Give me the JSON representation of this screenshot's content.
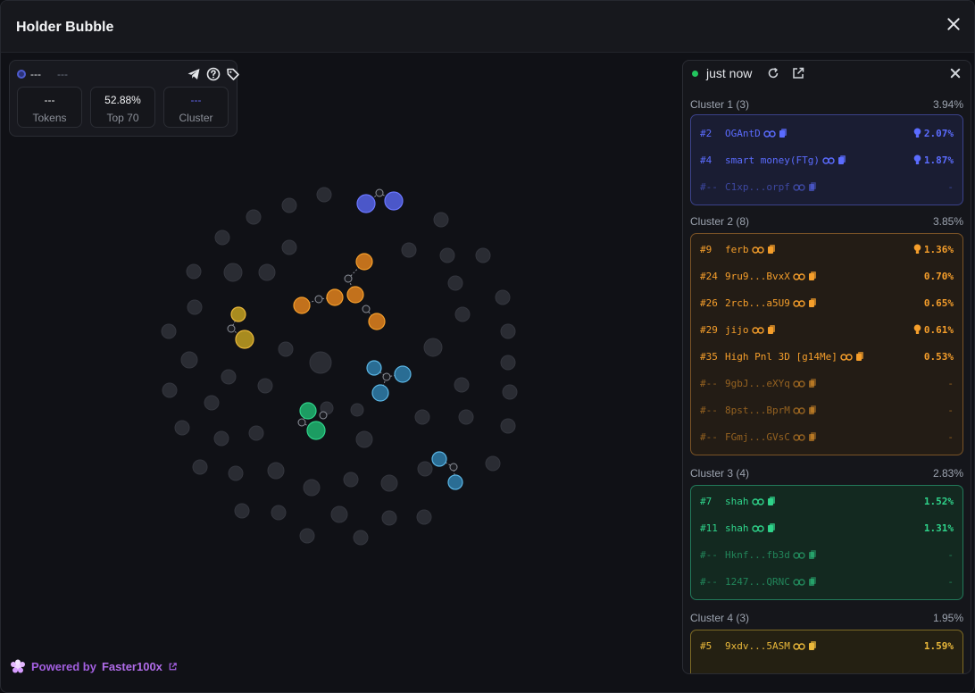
{
  "window": {
    "title": "Holder Bubble"
  },
  "token": {
    "name": "---",
    "symbol": "---"
  },
  "stats": [
    {
      "value": "---",
      "label": "Tokens"
    },
    {
      "value": "52.88%",
      "label": "Top 70"
    },
    {
      "value": "---",
      "label": "Cluster"
    }
  ],
  "panel": {
    "status": "just now"
  },
  "clusters": [
    {
      "title": "Cluster 1 (3)",
      "percent": "3.94%",
      "color": "#5b6cff",
      "bg": "#1a1d33",
      "border": "#3b428a",
      "rows": [
        {
          "rank": "#2",
          "name": "OGAntD",
          "percent": "2.07%",
          "bulb": true,
          "dim": false
        },
        {
          "rank": "#4",
          "name": "smart money(FTg)",
          "percent": "1.87%",
          "bulb": true,
          "dim": false
        },
        {
          "rank": "#--",
          "name": "C1xp...orpf",
          "percent": "-",
          "bulb": false,
          "dim": true
        }
      ]
    },
    {
      "title": "Cluster 2 (8)",
      "percent": "3.85%",
      "color": "#f59e2b",
      "bg": "#231c15",
      "border": "#7a5326",
      "rows": [
        {
          "rank": "#9",
          "name": "ferb",
          "percent": "1.36%",
          "bulb": true,
          "dim": false
        },
        {
          "rank": "#24",
          "name": "9ru9...BvxX",
          "percent": "0.70%",
          "bulb": false,
          "dim": false
        },
        {
          "rank": "#26",
          "name": "2rcb...a5U9",
          "percent": "0.65%",
          "bulb": false,
          "dim": false
        },
        {
          "rank": "#29",
          "name": "jijo",
          "percent": "0.61%",
          "bulb": true,
          "dim": false
        },
        {
          "rank": "#35",
          "name": "High Pnl 3D [g14Me]",
          "percent": "0.53%",
          "bulb": false,
          "dim": false
        },
        {
          "rank": "#--",
          "name": "9gbJ...eXYq",
          "percent": "-",
          "bulb": false,
          "dim": true
        },
        {
          "rank": "#--",
          "name": "8pst...BprM",
          "percent": "-",
          "bulb": false,
          "dim": true
        },
        {
          "rank": "#--",
          "name": "FGmj...GVsC",
          "percent": "-",
          "bulb": false,
          "dim": true
        }
      ]
    },
    {
      "title": "Cluster 3 (4)",
      "percent": "2.83%",
      "color": "#2fd38a",
      "bg": "#132920",
      "border": "#22795a",
      "rows": [
        {
          "rank": "#7",
          "name": "shah",
          "percent": "1.52%",
          "bulb": false,
          "dim": false
        },
        {
          "rank": "#11",
          "name": "shah",
          "percent": "1.31%",
          "bulb": false,
          "dim": false
        },
        {
          "rank": "#--",
          "name": "Hknf...fb3d",
          "percent": "-",
          "bulb": false,
          "dim": true
        },
        {
          "rank": "#--",
          "name": "1247...QRNC",
          "percent": "-",
          "bulb": false,
          "dim": true
        }
      ]
    },
    {
      "title": "Cluster 4 (3)",
      "percent": "1.95%",
      "color": "#eab83a",
      "bg": "#242012",
      "border": "#7d6a24",
      "rows": [
        {
          "rank": "#5",
          "name": "9xdv...5ASM",
          "percent": "1.59%",
          "bulb": false,
          "dim": false
        }
      ]
    }
  ],
  "footer": {
    "powered_by": "Powered by",
    "brand": "Faster100x"
  },
  "icons": {
    "telegram": "telegram-icon",
    "help": "help-icon",
    "tag": "tag-icon",
    "refresh": "refresh-icon",
    "external": "external-link-icon",
    "link": "link-icon",
    "copy": "copy-icon",
    "bulb": "bulb-icon",
    "logo": "logo-icon"
  }
}
